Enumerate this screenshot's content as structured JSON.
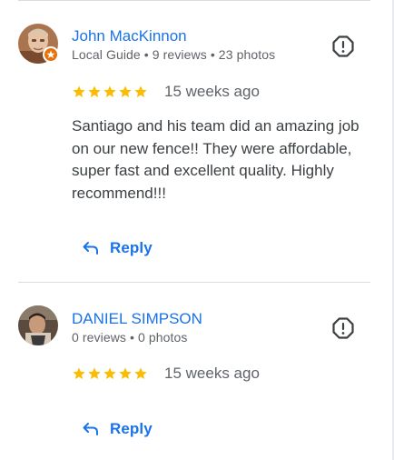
{
  "colors": {
    "accent": "#1a73e8",
    "star": "#fbbc04",
    "secondary_text": "#5f6368",
    "body_text": "#3c4043",
    "divider": "#dadce0",
    "local_guide_badge": "#e8710a"
  },
  "reviews": [
    {
      "author": "John MacKinnon",
      "meta": "Local Guide • 9 reviews • 23 photos",
      "local_guide": true,
      "rating": 5,
      "rating_max": 5,
      "time": "15 weeks ago",
      "text": "Santiago and his team did an amazing job on our new fence!! They were affordable, super fast and excellent quality. Highly recommend!!!",
      "reply_label": "Reply",
      "flag_icon": "report-flag-icon",
      "reply_icon": "reply-arrow-icon"
    },
    {
      "author": "DANIEL SIMPSON",
      "meta": "0 reviews • 0 photos",
      "local_guide": false,
      "rating": 5,
      "rating_max": 5,
      "time": "15 weeks ago",
      "text": "",
      "reply_label": "Reply",
      "flag_icon": "report-flag-icon",
      "reply_icon": "reply-arrow-icon"
    }
  ]
}
